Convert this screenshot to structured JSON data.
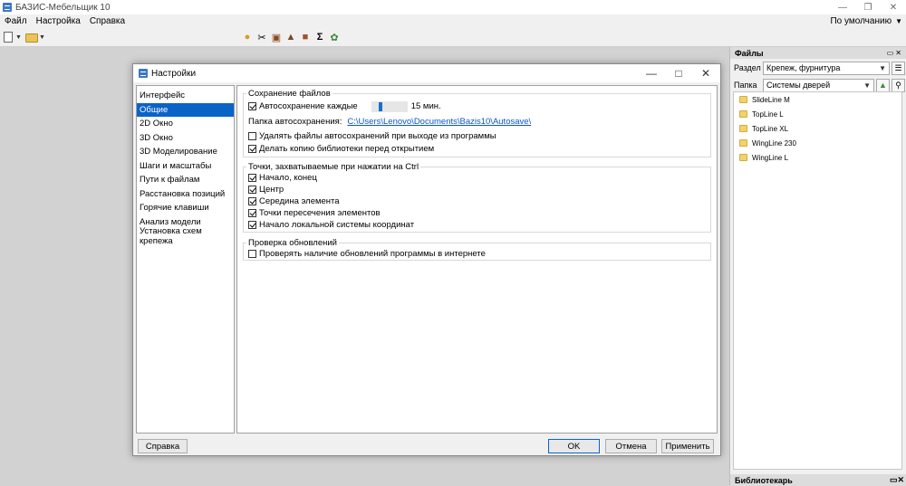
{
  "app": {
    "title": "БАЗИС-Мебельщик 10",
    "menu": [
      "Файл",
      "Настройка",
      "Справка"
    ],
    "profile": "По умолчанию"
  },
  "files_panel": {
    "title": "Файлы",
    "section_label": "Раздел",
    "section_value": "Крепеж, фурнитура",
    "folder_label": "Папка",
    "folder_value": "Системы дверей",
    "items": [
      "SlideLine M",
      "TopLine L",
      "TopLine XL",
      "WingLine 230",
      "WingLine L"
    ]
  },
  "library_panel": {
    "title": "Библиотекарь"
  },
  "dialog": {
    "title": "Настройки",
    "nav": [
      "Интерфейс",
      "Общие",
      "2D Окно",
      "3D Окно",
      "3D Моделирование",
      "Шаги и масштабы",
      "Пути к файлам",
      "Расстановка позиций",
      "Горячие клавиши",
      "Анализ модели",
      "Установка схем крепежа"
    ],
    "active_nav": "Общие",
    "save_group": {
      "title": "Сохранение файлов",
      "autosave_label": "Автосохранение каждые",
      "autosave_checked": true,
      "autosave_value": "15 мин.",
      "path_label": "Папка автосохранения:",
      "path_value": "C:\\Users\\Lenovo\\Documents\\Bazis10\\Autosave\\",
      "delete_label": "Удалять файлы автосохранений при выходе из программы",
      "delete_checked": false,
      "backup_label": "Делать копию библиотеки перед открытием",
      "backup_checked": true
    },
    "snap_group": {
      "title": "Точки, захватываемые при нажатии на Ctrl",
      "items": [
        {
          "label": "Начало, конец",
          "checked": true
        },
        {
          "label": "Центр",
          "checked": true
        },
        {
          "label": "Середина элемента",
          "checked": true
        },
        {
          "label": "Точки пересечения элементов",
          "checked": true
        },
        {
          "label": "Начало локальной системы координат",
          "checked": true
        }
      ]
    },
    "update_group": {
      "title": "Проверка обновлений",
      "check_label": "Проверять наличие обновлений программы в интернете",
      "check_checked": false
    },
    "buttons": {
      "help": "Справка",
      "ok": "OK",
      "cancel": "Отмена",
      "apply": "Применить"
    }
  }
}
